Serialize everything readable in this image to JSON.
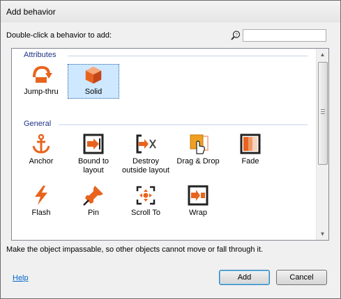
{
  "window": {
    "title": "Add behavior"
  },
  "prompt": "Double-click a behavior to add:",
  "search": {
    "value": "",
    "icon": "search-icon"
  },
  "groups": [
    {
      "name": "Attributes",
      "items": [
        {
          "label": "Jump-thru",
          "icon": "jump-thru-icon"
        },
        {
          "label": "Solid",
          "icon": "solid-cube-icon",
          "selected": true
        }
      ]
    },
    {
      "name": "General",
      "items": [
        {
          "label": "Anchor",
          "icon": "anchor-icon"
        },
        {
          "label": "Bound to layout",
          "icon": "bound-to-layout-icon"
        },
        {
          "label": "Destroy outside layout",
          "icon": "destroy-outside-layout-icon"
        },
        {
          "label": "Drag & Drop",
          "icon": "drag-drop-icon"
        },
        {
          "label": "Fade",
          "icon": "fade-icon"
        },
        {
          "label": "Flash",
          "icon": "flash-icon"
        },
        {
          "label": "Pin",
          "icon": "pin-icon"
        },
        {
          "label": "Scroll To",
          "icon": "scroll-to-icon"
        },
        {
          "label": "Wrap",
          "icon": "wrap-icon"
        }
      ]
    }
  ],
  "description": "Make the object impassable, so other objects cannot move or fall through it.",
  "footer": {
    "help": "Help",
    "add": "Add",
    "cancel": "Cancel"
  },
  "colors": {
    "accent_orange": "#e8641e",
    "header_blue": "#1e3287",
    "selection": "#cde8ff"
  }
}
